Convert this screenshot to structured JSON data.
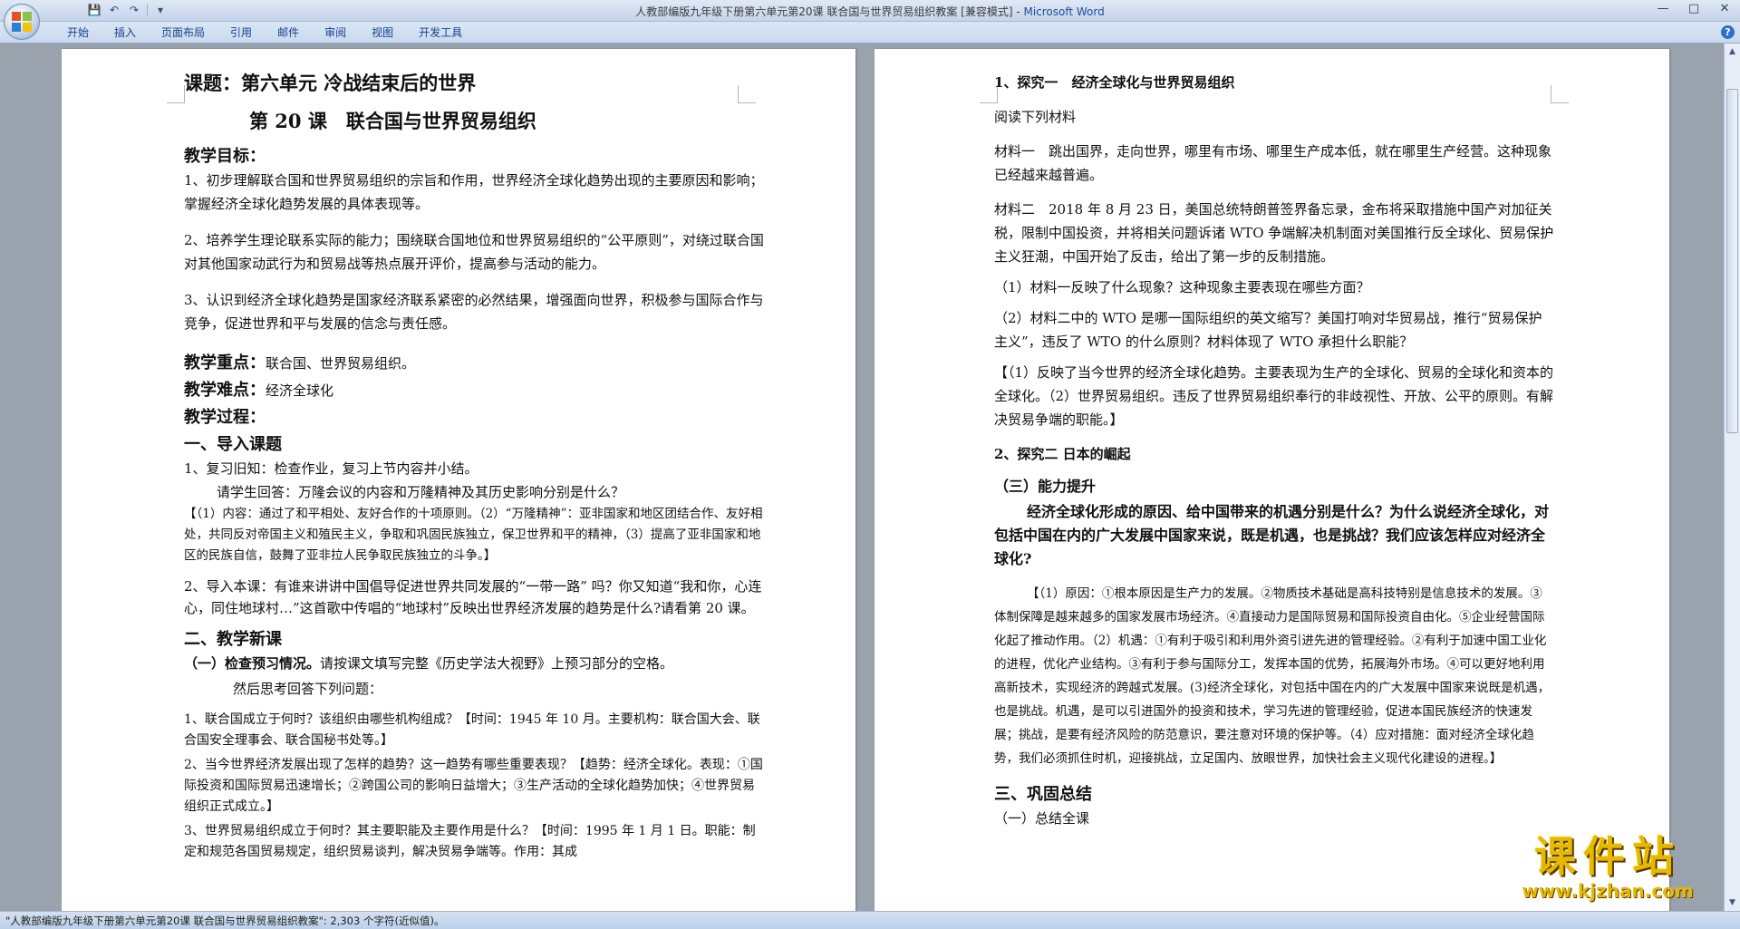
{
  "window": {
    "title": "人教部编版九年级下册第六单元第20课 联合国与世界贸易组织教案 [兼容模式] - ",
    "app_name": "Microsoft Word"
  },
  "qat": {
    "save": "💾",
    "undo": "↶",
    "redo": "↷",
    "more": "▾"
  },
  "window_controls": {
    "minimize": "—",
    "maximize": "□",
    "close": "✕"
  },
  "ribbon": {
    "tabs": [
      "开始",
      "插入",
      "页面布局",
      "引用",
      "邮件",
      "审阅",
      "视图",
      "开发工具"
    ],
    "help": "?"
  },
  "left_page": {
    "title1": "课题：第六单元 冷战结束后的世界",
    "title2": "第 20 课　联合国与世界贸易组织",
    "goals_heading": "教学目标：",
    "goal1": "1、初步理解联合国和世界贸易组织的宗旨和作用，世界经济全球化趋势出现的主要原因和影响；掌握经济全球化趋势发展的具体表现等。",
    "goal2": "2、培养学生理论联系实际的能力；围绕联合国地位和世界贸易组织的“公平原则”，对绕过联合国对其他国家动武行为和贸易战等热点展开评价，提高参与活动的能力。",
    "goal3": "3、认识到经济全球化趋势是国家经济联系紧密的必然结果，增强面向世界，积极参与国际合作与竞争，促进世界和平与发展的信念与责任感。",
    "key_label": "教学重点：",
    "key_text": "联合国、世界贸易组织。",
    "difficulty_label": "教学难点：",
    "difficulty_text": "经济全球化",
    "process": "教学过程：",
    "intro_heading": "一、导入课题",
    "review": "1、复习旧知：检查作业，复习上节内容并小结。",
    "review_q": "请学生回答：万隆会议的内容和万隆精神及其历史影响分别是什么？",
    "review_a": "【（1）内容：通过了和平相处、友好合作的十项原则。（2）“万隆精神”：亚非国家和地区团结合作、友好相处，共同反对帝国主义和殖民主义，争取和巩固民族独立，保卫世界和平的精神，（3）提高了亚非国家和地区的民族自信，鼓舞了亚非拉人民争取民族独立的斗争。】",
    "lead_in": "2、导入本课：有谁来讲讲中国倡导促进世界共同发展的“一带一路” 吗？你又知道“我和你，心连心，同住地球村…”这首歌中传唱的“地球村”反映出世界经济发展的趋势是什么?请看第 20 课。",
    "new_heading": "二、教学新课",
    "preview_label": "（一）检查预习情况。",
    "preview_text": "请按课文填写完整《历史学法大视野》上预习部分的空格。",
    "preview_then": "然后思考回答下列问题：",
    "q1": "1、联合国成立于何时？该组织由哪些机构组成？【时间：1945 年 10 月。主要机构：联合国大会、联合国安全理事会、联合国秘书处等。】",
    "q2": "2、当今世界经济发展出现了怎样的趋势？这一趋势有哪些重要表现？【趋势：经济全球化。表现：①国际投资和国际贸易迅速增长；②跨国公司的影响日益增大；③生产活动的全球化趋势加快；④世界贸易组织正式成立。】",
    "q3": "3、世界贸易组织成立于何时？其主要职能及主要作用是什么？【时间：1995 年 1 月 1 日。职能：制定和规范各国贸易规定，组织贸易谈判，解决贸易争端等。作用：其成"
  },
  "right_page": {
    "explore1": "1、探究一　经济全球化与世界贸易组织",
    "read": "阅读下列材料",
    "material1": "材料一　跳出国界，走向世界，哪里有市场、哪里生产成本低，就在哪里生产经营。这种现象已经越来越普遍。",
    "material2": "材料二　2018 年 8 月 23 日，美国总统特朗普签界备忘录，金布将采取措施中国产对加征关税，限制中国投资，并将相关问题诉诸 WTO 争端解决机制面对美国推行反全球化、贸易保护主义狂潮，中国开始了反击，给出了第一步的反制措施。",
    "rq1": "（1）材料一反映了什么现象？这种现象主要表现在哪些方面？",
    "rq2": "（2）材料二中的 WTO 是哪一国际组织的英文缩写？美国打响对华贸易战，推行“贸易保护主义”，违反了 WTO 的什么原则？材料体现了 WTO 承担什么职能？",
    "ra": "【（1）反映了当今世界的经济全球化趋势。主要表现为生产的全球化、贸易的全球化和资本的全球化。（2）世界贸易组织。违反了世界贸易组织奉行的非歧视性、开放、公平的原则。有解决贸易争端的职能。】",
    "explore2": "2、探究二 日本的崛起",
    "ability": "（三）能力提升",
    "ability_q": "经济全球化形成的原因、给中国带来的机遇分别是什么？为什么说经济全球化，对包括中国在内的广大发展中国家来说，既是机遇，也是挑战？我们应该怎样应对经济全球化?",
    "ability_a": "【（1）原因：①根本原因是生产力的发展。②物质技术基础是高科技特别是信息技术的发展。③体制保障是越来越多的国家发展市场经济。④直接动力是国际贸易和国际投资自由化。⑤企业经营国际化起了推动作用。（2）机遇：①有利于吸引和利用外资引进先进的管理经验。②有利于加速中国工业化的进程，优化产业结构。③有利于参与国际分工，发挥本国的优势，拓展海外市场。④可以更好地利用高新技术，实现经济的跨越式发展。(3)经济全球化，对包括中国在内的广大发展中国家来说既是机遇，也是挑战。机遇，是可以引进国外的投资和技术，学习先进的管理经验，促进本国民族经济的快速发展；挑战，是要有经济风险的防范意识，要注意对环境的保护等。（4）应对措施：面对经济全球化趋势，我们必须抓住时机，迎接挑战，立足国内、放眼世界，加快社会主义现代化建设的进程。】",
    "summary_heading": "三、巩固总结",
    "summary1": "（一）总结全课"
  },
  "status": {
    "text": "\"人教部编版九年级下册第六单元第20课 联合国与世界贸易组织教案\": 2,303 个字符(近似值)。"
  },
  "watermark": {
    "big": "课件站",
    "small": "www.kjzhan.com"
  }
}
